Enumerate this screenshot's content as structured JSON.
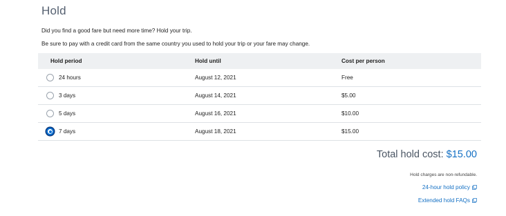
{
  "hold": {
    "title": "Hold",
    "intro_line1": "Did you find a good fare but need more time? Hold your trip.",
    "intro_line2": "Be sure to pay with a credit card from the same country you used to hold your trip or your fare may change.",
    "columns": [
      "Hold period",
      "Hold until",
      "Cost per person"
    ],
    "options": [
      {
        "period": "24 hours",
        "until": "August 12, 2021",
        "cost": "Free",
        "selected": false
      },
      {
        "period": "3 days",
        "until": "August 14, 2021",
        "cost": "$5.00",
        "selected": false
      },
      {
        "period": "5 days",
        "until": "August 16, 2021",
        "cost": "$10.00",
        "selected": false
      },
      {
        "period": "7 days",
        "until": "August 18, 2021",
        "cost": "$15.00",
        "selected": true
      }
    ],
    "total_label": "Total hold cost:",
    "total_amount": "$15.00",
    "refund_note": "Hold charges are non-refundable.",
    "links": {
      "policy": "24-hour hold policy",
      "faqs": "Extended hold FAQs"
    },
    "accent_color": "#1470c4"
  }
}
